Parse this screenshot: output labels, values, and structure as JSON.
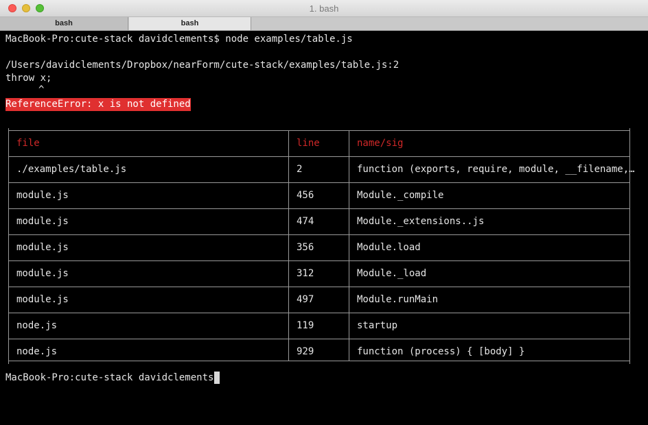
{
  "window": {
    "title": "1. bash"
  },
  "tabs": [
    {
      "label": "bash"
    },
    {
      "label": "bash"
    }
  ],
  "terminal": {
    "command_line": "MacBook-Pro:cute-stack davidclements$ node examples/table.js",
    "path_line": "/Users/davidclements/Dropbox/nearForm/cute-stack/examples/table.js:2",
    "code_line": "throw x;",
    "caret": "^",
    "error_text": "ReferenceError: x is not defined",
    "prompt": "MacBook-Pro:cute-stack davidclements$ "
  },
  "table": {
    "headers": [
      "file",
      "line",
      "name/sig"
    ],
    "rows": [
      [
        "./examples/table.js",
        "2",
        "function (exports, require, module, __filename,…"
      ],
      [
        "module.js",
        "456",
        "Module._compile"
      ],
      [
        "module.js",
        "474",
        "Module._extensions..js"
      ],
      [
        "module.js",
        "356",
        "Module.load"
      ],
      [
        "module.js",
        "312",
        "Module._load"
      ],
      [
        "module.js",
        "497",
        "Module.runMain"
      ],
      [
        "node.js",
        "119",
        "startup"
      ],
      [
        "node.js",
        "929",
        "function (process) { [body] }"
      ]
    ]
  },
  "colors": {
    "error_bg": "#e03030",
    "header_text": "#d02828",
    "background": "#000000"
  }
}
